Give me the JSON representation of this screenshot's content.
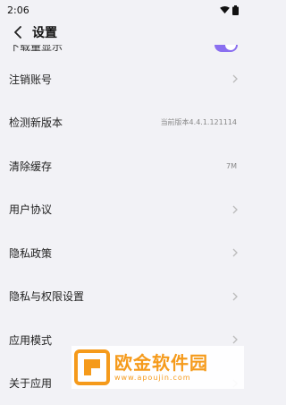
{
  "status_bar": {
    "time": "2:06"
  },
  "header": {
    "title": "设置"
  },
  "partial_item": {
    "label": "下载量显示"
  },
  "items": [
    {
      "label": "注销账号",
      "value": ""
    },
    {
      "label": "检测新版本",
      "value": "当前版本4.4.1.121114"
    },
    {
      "label": "清除缓存",
      "value": "7M"
    },
    {
      "label": "用户协议",
      "value": ""
    },
    {
      "label": "隐私政策",
      "value": ""
    },
    {
      "label": "隐私与权限设置",
      "value": ""
    },
    {
      "label": "应用模式",
      "value": ""
    },
    {
      "label": "关于应用",
      "value": ""
    }
  ],
  "watermark": {
    "title": "欧金软件园",
    "subtitle": "www.apoujin.com"
  },
  "colors": {
    "toggle": "#8a6ff0",
    "watermark": "#f59a1b",
    "background": "#f2f2f6"
  }
}
